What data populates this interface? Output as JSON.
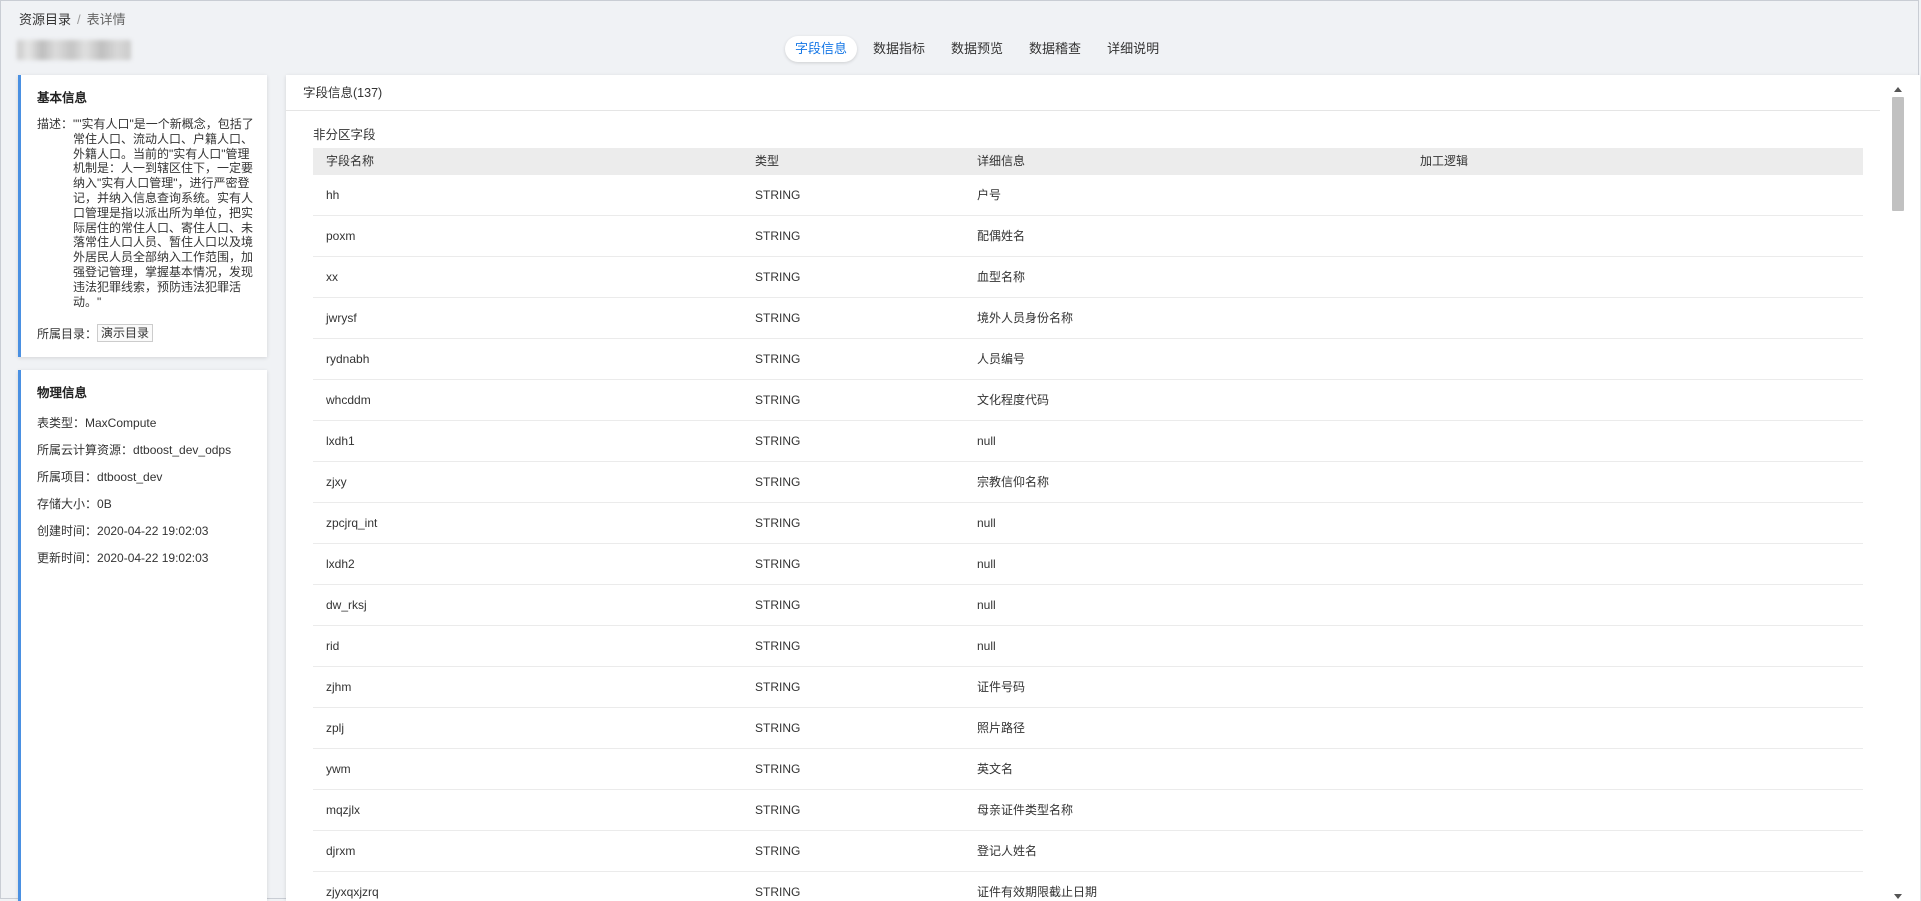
{
  "breadcrumb": {
    "root": "资源目录",
    "separator": "/",
    "current": "表详情"
  },
  "tabs": [
    {
      "label": "字段信息",
      "active": true
    },
    {
      "label": "数据指标",
      "active": false
    },
    {
      "label": "数据预览",
      "active": false
    },
    {
      "label": "数据稽查",
      "active": false
    },
    {
      "label": "详细说明",
      "active": false
    }
  ],
  "basic_info": {
    "title": "基本信息",
    "desc_label": "描述：",
    "desc_text": "\"\"实有人口\"是一个新概念，包括了常住人口、流动人口、户籍人口、外籍人口。当前的\"实有人口\"管理机制是：人一到辖区住下，一定要纳入\"实有人口管理\"，进行严密登记，并纳入信息查询系统。实有人口管理是指以派出所为单位，把实际居住的常住人口、寄住人口、未落常住人口人员、暂住人口以及境外居民人员全部纳入工作范围，加强登记管理，掌握基本情况，发现违法犯罪线索，预防违法犯罪活动。\"",
    "catalog_label": "所属目录：",
    "catalog_value": "演示目录"
  },
  "physical_info": {
    "title": "物理信息",
    "items": [
      {
        "label": "表类型：",
        "value": "MaxCompute"
      },
      {
        "label": "所属云计算资源：",
        "value": "dtboost_dev_odps"
      },
      {
        "label": "所属项目：",
        "value": "dtboost_dev"
      },
      {
        "label": "存储大小：",
        "value": "0B"
      },
      {
        "label": "创建时间：",
        "value": "2020-04-22 19:02:03"
      },
      {
        "label": "更新时间：",
        "value": "2020-04-22 19:02:03"
      }
    ]
  },
  "fields": {
    "header_label": "字段信息(137)",
    "section_label": "非分区字段",
    "columns": [
      "字段名称",
      "类型",
      "详细信息",
      "加工逻辑"
    ],
    "rows": [
      [
        "hh",
        "STRING",
        "户号",
        ""
      ],
      [
        "poxm",
        "STRING",
        "配偶姓名",
        ""
      ],
      [
        "xx",
        "STRING",
        "血型名称",
        ""
      ],
      [
        "jwrysf",
        "STRING",
        "境外人员身份名称",
        ""
      ],
      [
        "rydnabh",
        "STRING",
        "人员编号",
        ""
      ],
      [
        "whcddm",
        "STRING",
        "文化程度代码",
        ""
      ],
      [
        "lxdh1",
        "STRING",
        "null",
        ""
      ],
      [
        "zjxy",
        "STRING",
        "宗教信仰名称",
        ""
      ],
      [
        "zpcjrq_int",
        "STRING",
        "null",
        ""
      ],
      [
        "lxdh2",
        "STRING",
        "null",
        ""
      ],
      [
        "dw_rksj",
        "STRING",
        "null",
        ""
      ],
      [
        "rid",
        "STRING",
        "null",
        ""
      ],
      [
        "zjhm",
        "STRING",
        "证件号码",
        ""
      ],
      [
        "zplj",
        "STRING",
        "照片路径",
        ""
      ],
      [
        "ywm",
        "STRING",
        "英文名",
        ""
      ],
      [
        "mqzjlx",
        "STRING",
        "母亲证件类型名称",
        ""
      ],
      [
        "djrxm",
        "STRING",
        "登记人姓名",
        ""
      ],
      [
        "zjyxqxjzrq",
        "STRING",
        "证件有效期限截止日期",
        ""
      ]
    ]
  }
}
